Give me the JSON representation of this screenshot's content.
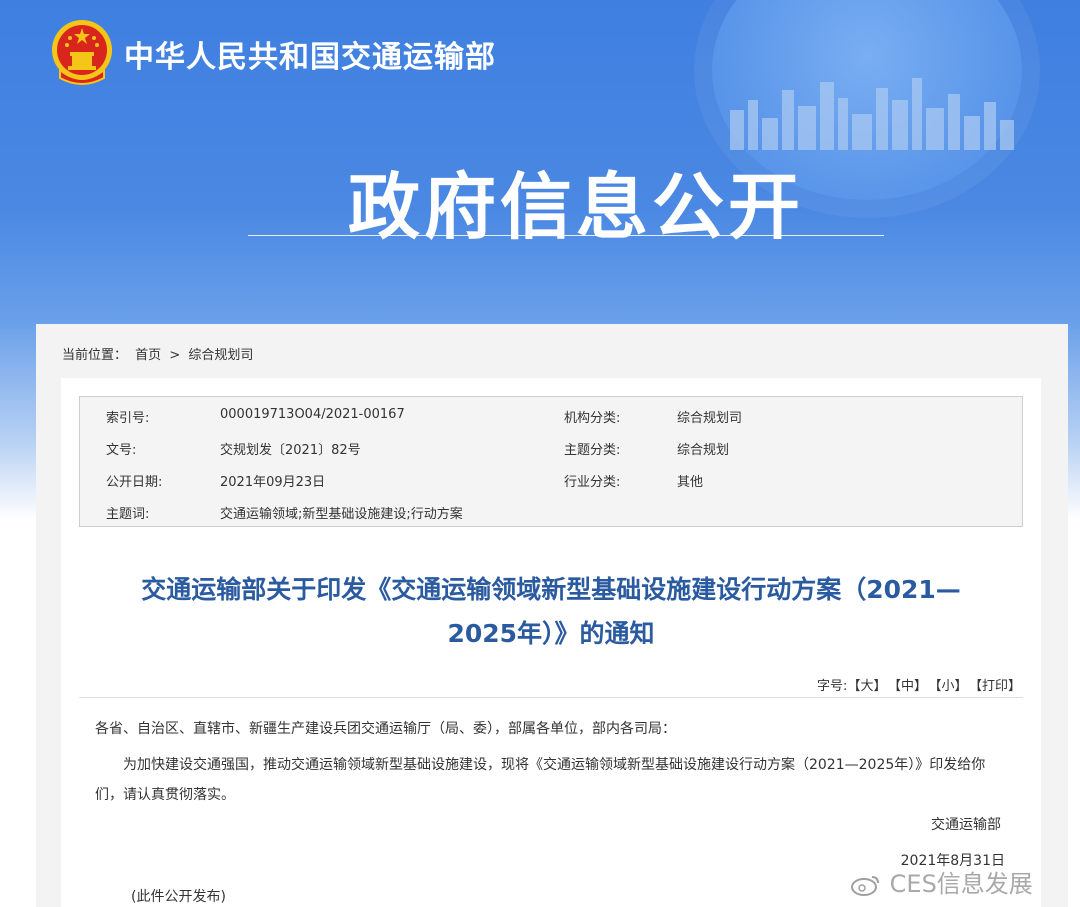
{
  "header": {
    "ministry_name": "中华人民共和国交通运输部",
    "page_heading": "政府信息公开"
  },
  "breadcrumb": {
    "prefix": "当前位置：",
    "home": "首页",
    "separator": ">",
    "current": "综合规划司"
  },
  "meta": {
    "index_label": "索引号:",
    "index_value": "000019713O04/2021-00167",
    "org_label": "机构分类:",
    "org_value": "综合规划司",
    "docno_label": "文号:",
    "docno_value": "交规划发〔2021〕82号",
    "topic_label": "主题分类:",
    "topic_value": "综合规划",
    "date_label": "公开日期:",
    "date_value": "2021年09月23日",
    "industry_label": "行业分类:",
    "industry_value": "其他",
    "keywords_label": "主题词:",
    "keywords_value": "交通运输领域;新型基础设施建设;行动方案"
  },
  "document": {
    "title_line1": "交通运输部关于印发《交通运输领域新型基础设施建设行动方案（2021—",
    "title_line2": "2025年）》的通知",
    "addressee": "各省、自治区、直辖市、新疆生产建设兵团交通运输厅（局、委），部属各单位，部内各司局：",
    "body": "为加快建设交通强国，推动交通运输领域新型基础设施建设，现将《交通运输领域新型基础设施建设行动方案（2021—2025年）》印发给你们，请认真贯彻落实。",
    "signature": "交通运输部",
    "date": "2021年8月31日",
    "note": "(此件公开发布)"
  },
  "font_tools": {
    "label": "字号:",
    "large": "【大】",
    "medium": "【中】",
    "small": "【小】",
    "print": "【打印】"
  },
  "watermark": {
    "text": "CES信息发展"
  },
  "colors": {
    "banner_blue": "#3f7fe0",
    "title_blue": "#2a5aa0",
    "emblem_red": "#d8261c",
    "emblem_gold": "#f5c518"
  }
}
